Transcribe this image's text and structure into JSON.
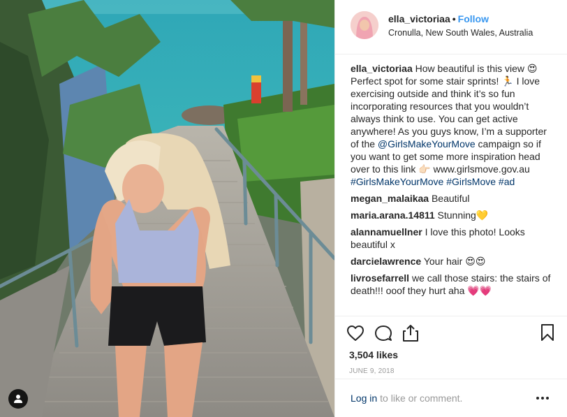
{
  "post": {
    "username": "ella_victoriaa",
    "follow_label": "Follow",
    "location": "Cronulla, New South Wales, Australia",
    "caption": {
      "text_1": "How beautiful is this view 😍 Perfect spot for some stair sprints! 🏃 I love exercising outside and think it’s so fun incorporating resources that you wouldn’t always think to use. You can get active anywhere! As you guys know, I’m a supporter of the ",
      "mention": "@GirlsMakeYourMove",
      "text_2": " campaign so if you want to get some more inspiration head over to this link 👉🏻 www.girlsmove.gov.au ",
      "hashtag_1": "#GirlsMakeYourMove",
      "hashtag_2": "#GirlsMove",
      "hashtag_3": "#ad"
    },
    "comments": [
      {
        "user": "megan_malaikaa",
        "text": "Beautiful"
      },
      {
        "user": "maria.arana.14811",
        "text": "Stunning💛"
      },
      {
        "user": "alannamuellner",
        "text": "I love this photo! Looks beautiful x"
      },
      {
        "user": "darcielawrence",
        "text": "Your hair 😍😍"
      },
      {
        "user": "livrosefarrell",
        "text": "we call those stairs: the stairs of death!!! ooof they hurt aha 💗💗"
      }
    ],
    "likes": "3,504 likes",
    "date": "JUNE 9, 2018",
    "login_link": "Log in",
    "login_rest": "to like or comment."
  },
  "icons": {
    "like": "heart-icon",
    "comment": "comment-icon",
    "share": "share-icon",
    "save": "bookmark-icon",
    "more": "more-options-icon",
    "tag": "user-tag-icon"
  },
  "colors": {
    "link_blue": "#3897f0",
    "text_dark": "#262626",
    "hashtag_navy": "#003569",
    "muted": "#999999"
  }
}
